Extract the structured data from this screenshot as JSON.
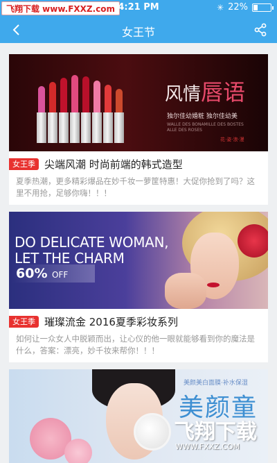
{
  "status_bar": {
    "watermark": "飞翔下载 www.FXXZ.com",
    "time": "4:21 PM",
    "battery_text": "22%",
    "battery_level": 0.22
  },
  "nav": {
    "title": "女王节",
    "back_icon": "chevron-left-icon",
    "share_icon": "share-icon"
  },
  "cards": [
    {
      "tag": "女王季",
      "title": "尖端风潮  时尚前端的韩式造型",
      "desc": "夏季热潮，更多精彩爆品在妙千妆一萝筐特惠！大促你抢到了吗？这里不用抢，足够你嗨！！！",
      "banner": {
        "script_main": "风情",
        "script_accent": "唇语",
        "line": "独尔佳幼婚粧  独尔佳幼美",
        "small": "WALLE DES BONAMILLE DES BOSTES ALLE DES ROSES",
        "stamp": "花·姿·浪·漫"
      }
    },
    {
      "tag": "女王季",
      "title": "璀璨流金  2016夏季彩妆系列",
      "desc": "如何让一众女人中脱颖而出，让心仪的他一眼就能够看到你的魔法是什么，答案：漂亮，妙千妆来帮你！！！",
      "banner": {
        "line1": "DO DELICATE WOMAN,",
        "line2": "LET THE CHARM",
        "off_value": "60%",
        "off_label": "OFF"
      }
    },
    {
      "banner": {
        "small": "美颜美白面膜·补水保湿",
        "big": "美颜童"
      }
    }
  ],
  "watermark_bottom": {
    "text": "飞翔下载",
    "url": "WWW.FXXZ.COM"
  },
  "colors": {
    "primary": "#3fa9ec",
    "tag": "#e8312f",
    "desc": "#999999"
  }
}
